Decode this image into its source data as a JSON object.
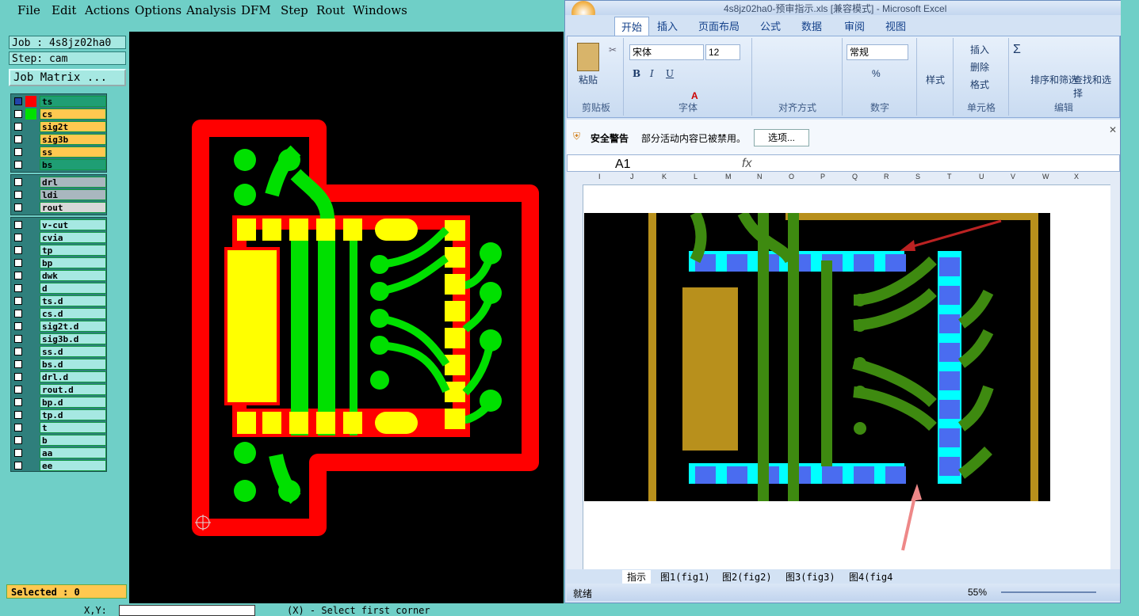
{
  "cam": {
    "menu": [
      "File",
      "Edit",
      "Actions",
      "Options",
      "Analysis",
      "DFM",
      "Step",
      "Rout",
      "Windows"
    ],
    "job_label": "Job : 4s8jz02ha0",
    "step_label": "Step: cam",
    "job_matrix_button": "Job Matrix ...",
    "layers_group1": [
      {
        "name": "ts",
        "color": "#ff0000",
        "bg": "#1f9e74",
        "selected": true
      },
      {
        "name": "cs",
        "color": "#00e000",
        "bg": "#ffc850"
      },
      {
        "name": "sig2t",
        "color": "",
        "bg": "#ffc850"
      },
      {
        "name": "sig3b",
        "color": "",
        "bg": "#ffc850"
      },
      {
        "name": "ss",
        "color": "",
        "bg": "#ffc850"
      },
      {
        "name": "bs",
        "color": "",
        "bg": "#1f9e74"
      }
    ],
    "layers_group2": [
      {
        "name": "drl",
        "bg": "#a9b7bf"
      },
      {
        "name": "ldi",
        "bg": "#a9b7bf"
      },
      {
        "name": "rout",
        "bg": "#d8d8d8"
      }
    ],
    "layers_group3": [
      "v-cut",
      "cvia",
      "tp",
      "bp",
      "dwk",
      "d",
      "ts.d",
      "cs.d",
      "sig2t.d",
      "sig3b.d",
      "ss.d",
      "bs.d",
      "drl.d",
      "rout.d",
      "bp.d",
      "tp.d",
      "t",
      "b",
      "aa",
      "ee"
    ],
    "selected_status": "Selected : 0",
    "status_prompt": "(X) - Select first corner",
    "status_xy_label": "X,Y:"
  },
  "excel": {
    "title": "4s8jz02ha0-预审指示.xls [兼容模式] - Microsoft Excel",
    "tabs": [
      "开始",
      "插入",
      "页面布局",
      "公式",
      "数据",
      "审阅",
      "视图"
    ],
    "ribbon": {
      "paste": "粘贴",
      "clipboard": "剪贴板",
      "font_name": "宋体",
      "font_size": "12",
      "font_group": "字体",
      "align_group": "对齐方式",
      "number_format": "常规",
      "number_group": "数字",
      "style": "样式",
      "insert": "插入",
      "delete": "删除",
      "format": "格式",
      "cells_group": "单元格",
      "sort_filter": "排序和筛选",
      "find_select": "查找和选择",
      "edit_group": "编辑"
    },
    "warning_title": "安全警告",
    "warning_text": "部分活动内容已被禁用。",
    "options_button": "选项...",
    "name_box": "A1",
    "fx": "fx",
    "columns": [
      "I",
      "J",
      "K",
      "L",
      "M",
      "N",
      "O",
      "P",
      "Q",
      "R",
      "S",
      "T",
      "U",
      "V",
      "W",
      "X"
    ],
    "sheets": [
      "指示",
      "图1(fig1)",
      "图2(fig2)",
      "图3(fig3)",
      "图4(fig4"
    ],
    "status_ready": "就绪",
    "zoom": "55%",
    "colors": {
      "title": "#15428b",
      "accent": "#4a6fa5"
    }
  }
}
